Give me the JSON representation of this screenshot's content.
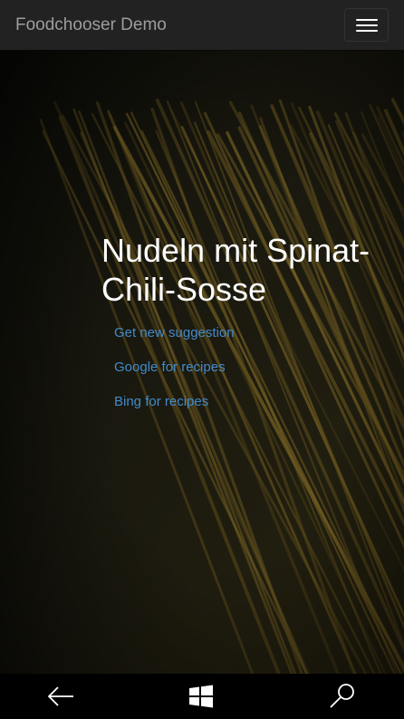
{
  "navbar": {
    "brand": "Foodchooser Demo",
    "menu_icon": "hamburger-menu-icon"
  },
  "hero": {
    "title": "Nudeln mit Spinat-Chili-Sosse",
    "links": [
      {
        "label": "Get new suggestion"
      },
      {
        "label": "Google for recipes"
      },
      {
        "label": "Bing for recipes"
      }
    ],
    "link_color": "#428bca"
  },
  "system_bar": {
    "back_icon": "back-arrow-icon",
    "windows_icon": "windows-logo-icon",
    "search_icon": "search-icon"
  },
  "colors": {
    "navbar_bg": "#222222",
    "brand_text": "#9d9d9d",
    "title_text": "#ffffff"
  }
}
